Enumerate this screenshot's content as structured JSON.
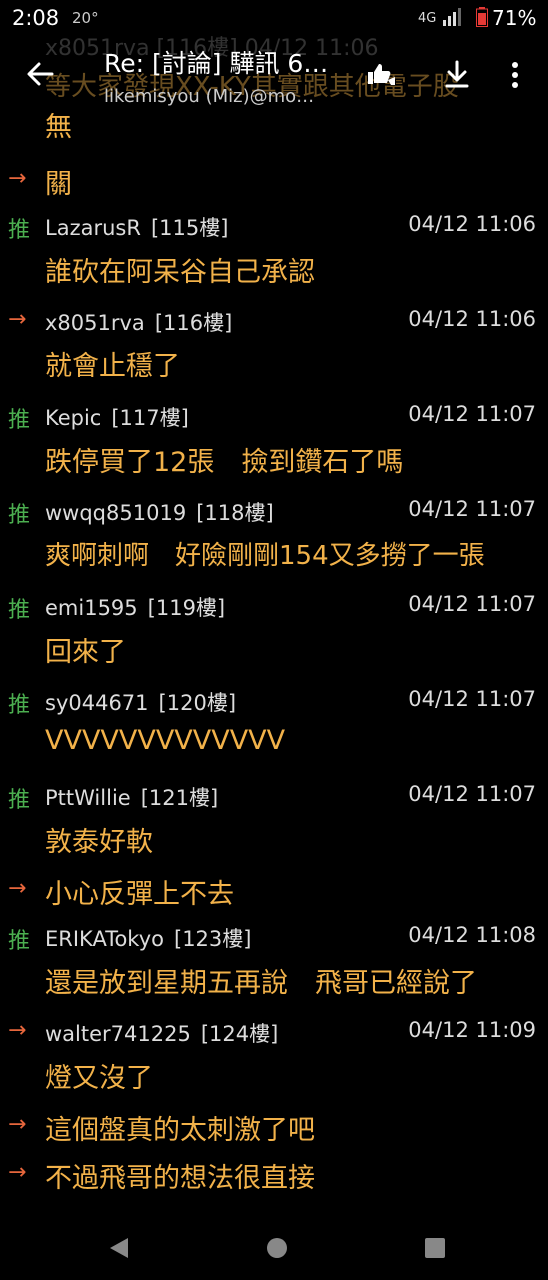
{
  "status_bar": {
    "time": "2:08",
    "temperature": "20°",
    "network": "4G",
    "battery": "71%"
  },
  "toolbar": {
    "title": "Re: [討論] 驊訊 6…",
    "subtitle": "likemisyou (Miz)@mo…",
    "ghost_top_text": "x8051rva [116樓] 04/12 11:06",
    "ghost_text": "等大家發現XX-KY其實跟其他電子股"
  },
  "colors": {
    "push": "#4caf50",
    "arrow": "#e6663c",
    "content": "#f2b24a"
  },
  "comments": [
    {
      "type": "continuation",
      "text": "無"
    },
    {
      "type": "arrow",
      "text": "關"
    },
    {
      "type": "push",
      "user": "LazarusR",
      "floor": "[115樓]",
      "time": "04/12 11:06",
      "text": "誰砍在阿呆谷自己承認"
    },
    {
      "type": "arrow",
      "user": "x8051rva",
      "floor": "[116樓]",
      "time": "04/12 11:06",
      "text": "就會止穩了"
    },
    {
      "type": "push",
      "user": "Kepic",
      "floor": "[117樓]",
      "time": "04/12 11:07",
      "text": "跌停買了12張　撿到鑽石了嗎"
    },
    {
      "type": "push",
      "user": "wwqq851019",
      "floor": "[118樓]",
      "time": "04/12 11:07",
      "text": "爽啊刺啊　好險剛剛154又多撈了一張"
    },
    {
      "type": "push",
      "user": "emi1595",
      "floor": "[119樓]",
      "time": "04/12 11:07",
      "text": "回來了"
    },
    {
      "type": "push",
      "user": "sy044671",
      "floor": "[120樓]",
      "time": "04/12 11:07",
      "text": "VVVVVVVVVVVVV"
    },
    {
      "type": "push",
      "user": "PttWillie",
      "floor": "[121樓]",
      "time": "04/12 11:07",
      "text": "敦泰好軟"
    },
    {
      "type": "arrow",
      "text": "小心反彈上不去"
    },
    {
      "type": "push",
      "user": "ERIKATokyo",
      "floor": "[123樓]",
      "time": "04/12 11:08",
      "text": "還是放到星期五再說　飛哥已經說了"
    },
    {
      "type": "arrow",
      "user": "walter741225",
      "floor": "[124樓]",
      "time": "04/12 11:09",
      "text": "燈又沒了"
    },
    {
      "type": "arrow",
      "text": "這個盤真的太刺激了吧"
    },
    {
      "type": "arrow",
      "text": "不過飛哥的想法很直接"
    }
  ],
  "tags": {
    "push": "推",
    "arrow": "→"
  }
}
